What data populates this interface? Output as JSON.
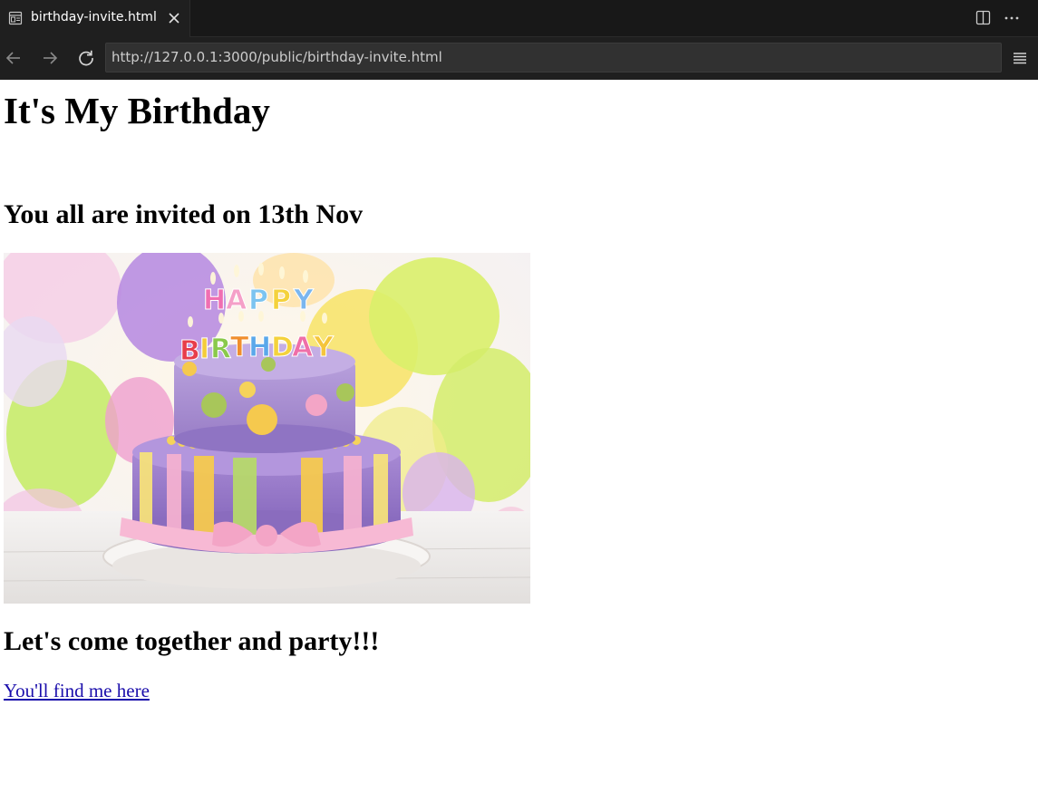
{
  "browser": {
    "tab": {
      "title": "birthday-invite.html",
      "page_icon": "browser-page-icon",
      "close_icon": "close-icon"
    },
    "toolbar": {
      "split_icon": "split-editor-icon",
      "more_icon": "more-actions-icon",
      "back_icon": "arrow-left-icon",
      "forward_icon": "arrow-right-icon",
      "reload_icon": "reload-icon",
      "menu_icon": "hamburger-menu-icon"
    },
    "url": "http://127.0.0.1:3000/public/birthday-invite.html"
  },
  "page": {
    "heading": "It's My Birthday",
    "invite_text": "You all are invited on 13th Nov",
    "image": {
      "description_icon": "birthday-cake-image",
      "cake_text": "HAPPY BIRTHDAY"
    },
    "party_text": "Let's come together and party!!!",
    "link_text": "You'll find me here"
  },
  "colors": {
    "chrome_background": "#1f1f1f",
    "tabbar_background": "#181818",
    "url_background": "#313131",
    "link": "#1a0dab"
  }
}
